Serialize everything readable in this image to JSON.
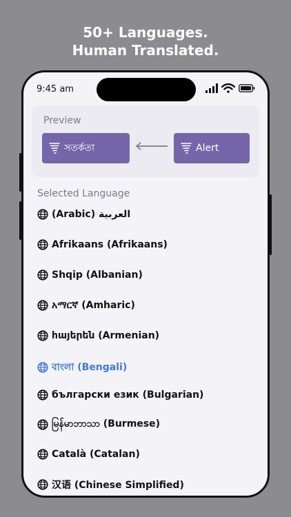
{
  "headline": {
    "line1": "50+ Languages.",
    "line2": "Human Translated."
  },
  "status_bar": {
    "time": "9:45 am"
  },
  "preview": {
    "label": "Preview",
    "translated_text": "সতর্কতা",
    "source_text": "Alert"
  },
  "section_title": "Selected Language",
  "colors": {
    "accent_purple": "#7466a9",
    "selected_blue": "#3d7be0",
    "background": "#8c8b90"
  },
  "languages": [
    {
      "label": "(Arabic) العربية"
    },
    {
      "label": "Afrikaans (Afrikaans)"
    },
    {
      "label": "Shqip (Albanian)"
    },
    {
      "label": "አማርኛ (Amharic)"
    },
    {
      "label": "հայերեն (Armenian)"
    },
    {
      "label": "বাংলা (Bengali)"
    },
    {
      "label": "български език (Bulgarian)"
    },
    {
      "label": "မြန်မာဘာသာ (Burmese)"
    },
    {
      "label": "Català (Catalan)"
    },
    {
      "label": "汉语 (Chinese Simplified)"
    }
  ]
}
